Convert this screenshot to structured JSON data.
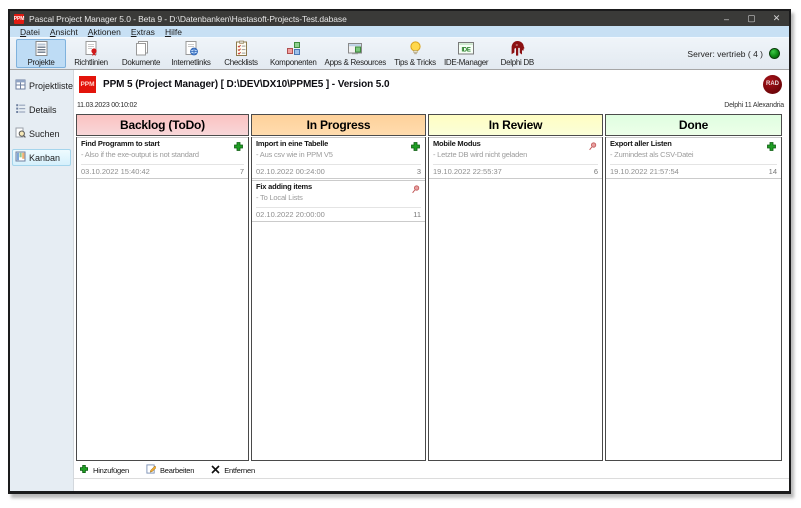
{
  "window": {
    "title": "Pascal Project Manager 5.0 - Beta 9 - D:\\Datenbanken\\Hastasoft-Projects-Test.dabase",
    "app_badge": "PPM",
    "controls": {
      "minimize": "–",
      "maximize": "▢",
      "close": "✕"
    }
  },
  "menu": [
    "Datei",
    "Ansicht",
    "Aktionen",
    "Extras",
    "Hilfe"
  ],
  "toolbar": {
    "buttons": [
      {
        "label": "Projekte",
        "icon": "projects-icon",
        "selected": true
      },
      {
        "label": "Richtlinien",
        "icon": "guidelines-icon",
        "selected": false
      },
      {
        "label": "Dokumente",
        "icon": "documents-icon",
        "selected": false
      },
      {
        "label": "Internetlinks",
        "icon": "internetlinks-icon",
        "selected": false
      },
      {
        "label": "Checklists",
        "icon": "checklists-icon",
        "selected": false
      },
      {
        "label": "Komponenten",
        "icon": "components-icon",
        "selected": false
      },
      {
        "label": "Apps & Resources",
        "icon": "apps-icon",
        "selected": false
      },
      {
        "label": "Tips & Tricks",
        "icon": "tips-icon",
        "selected": false
      },
      {
        "label": "IDE-Manager",
        "icon": "ide-icon",
        "selected": false
      },
      {
        "label": "Delphi DB",
        "icon": "delphi-icon",
        "selected": false
      }
    ],
    "server_status": "Server: vertrieb ( 4 )"
  },
  "sidebar": [
    {
      "label": "Projektliste",
      "icon": "project-list-icon",
      "selected": false
    },
    {
      "label": "Details",
      "icon": "details-icon",
      "selected": false
    },
    {
      "label": "Suchen",
      "icon": "search-icon",
      "selected": false
    },
    {
      "label": "Kanban",
      "icon": "kanban-icon",
      "selected": true
    }
  ],
  "header": {
    "app_badge": "PPM",
    "title": "PPM 5 (Project Manager) [ D:\\DEV\\DX10\\PPME5 ]  - Version 5.0",
    "timestamp": "11.03.2023 00:10:02",
    "rad_badge": "RAD",
    "delphi_version": "Delphi 11 Alexandria"
  },
  "kanban": {
    "columns": [
      {
        "title": "Backlog (ToDo)",
        "color_top": "#fbc2c1",
        "color_bottom": "#f8d7d9",
        "cards": [
          {
            "title": "Find Programm to start",
            "note": "- Also if the exe-output is not standard",
            "date": "03.10.2022 15:40:42",
            "count": "7",
            "icon": "plus-icon"
          }
        ]
      },
      {
        "title": "In Progress",
        "color_top": "#fed19a",
        "color_bottom": "#ffdcae",
        "cards": [
          {
            "title": "Import in eine Tabelle",
            "note": "- Aus csv wie in PPM V5",
            "date": "02.10.2022 00:24:00",
            "count": "3",
            "icon": "plus-icon"
          },
          {
            "title": "Fix adding items",
            "note": "- To Local Lists",
            "date": "02.10.2022 20:00:00",
            "count": "11",
            "icon": "pin-icon"
          }
        ]
      },
      {
        "title": "In Review",
        "color_top": "#fffdc2",
        "color_bottom": "#fbffd9",
        "cards": [
          {
            "title": "Mobile Modus",
            "note": "- Letzte DB wird nicht geladen",
            "date": "19.10.2022 22:55:37",
            "count": "6",
            "icon": "pin-icon"
          }
        ]
      },
      {
        "title": "Done",
        "color_top": "#dffee0",
        "color_bottom": "#edffe9",
        "cards": [
          {
            "title": "Export aller Listen",
            "note": "- Zumindest als CSV-Datei",
            "date": "19.10.2022 21:57:54",
            "count": "14",
            "icon": "plus-icon"
          }
        ]
      }
    ]
  },
  "footer": {
    "buttons": [
      {
        "label": "Hinzufügen",
        "icon": "add-icon"
      },
      {
        "label": "Bearbeiten",
        "icon": "edit-icon"
      },
      {
        "label": "Entfernen",
        "icon": "remove-icon"
      }
    ]
  }
}
